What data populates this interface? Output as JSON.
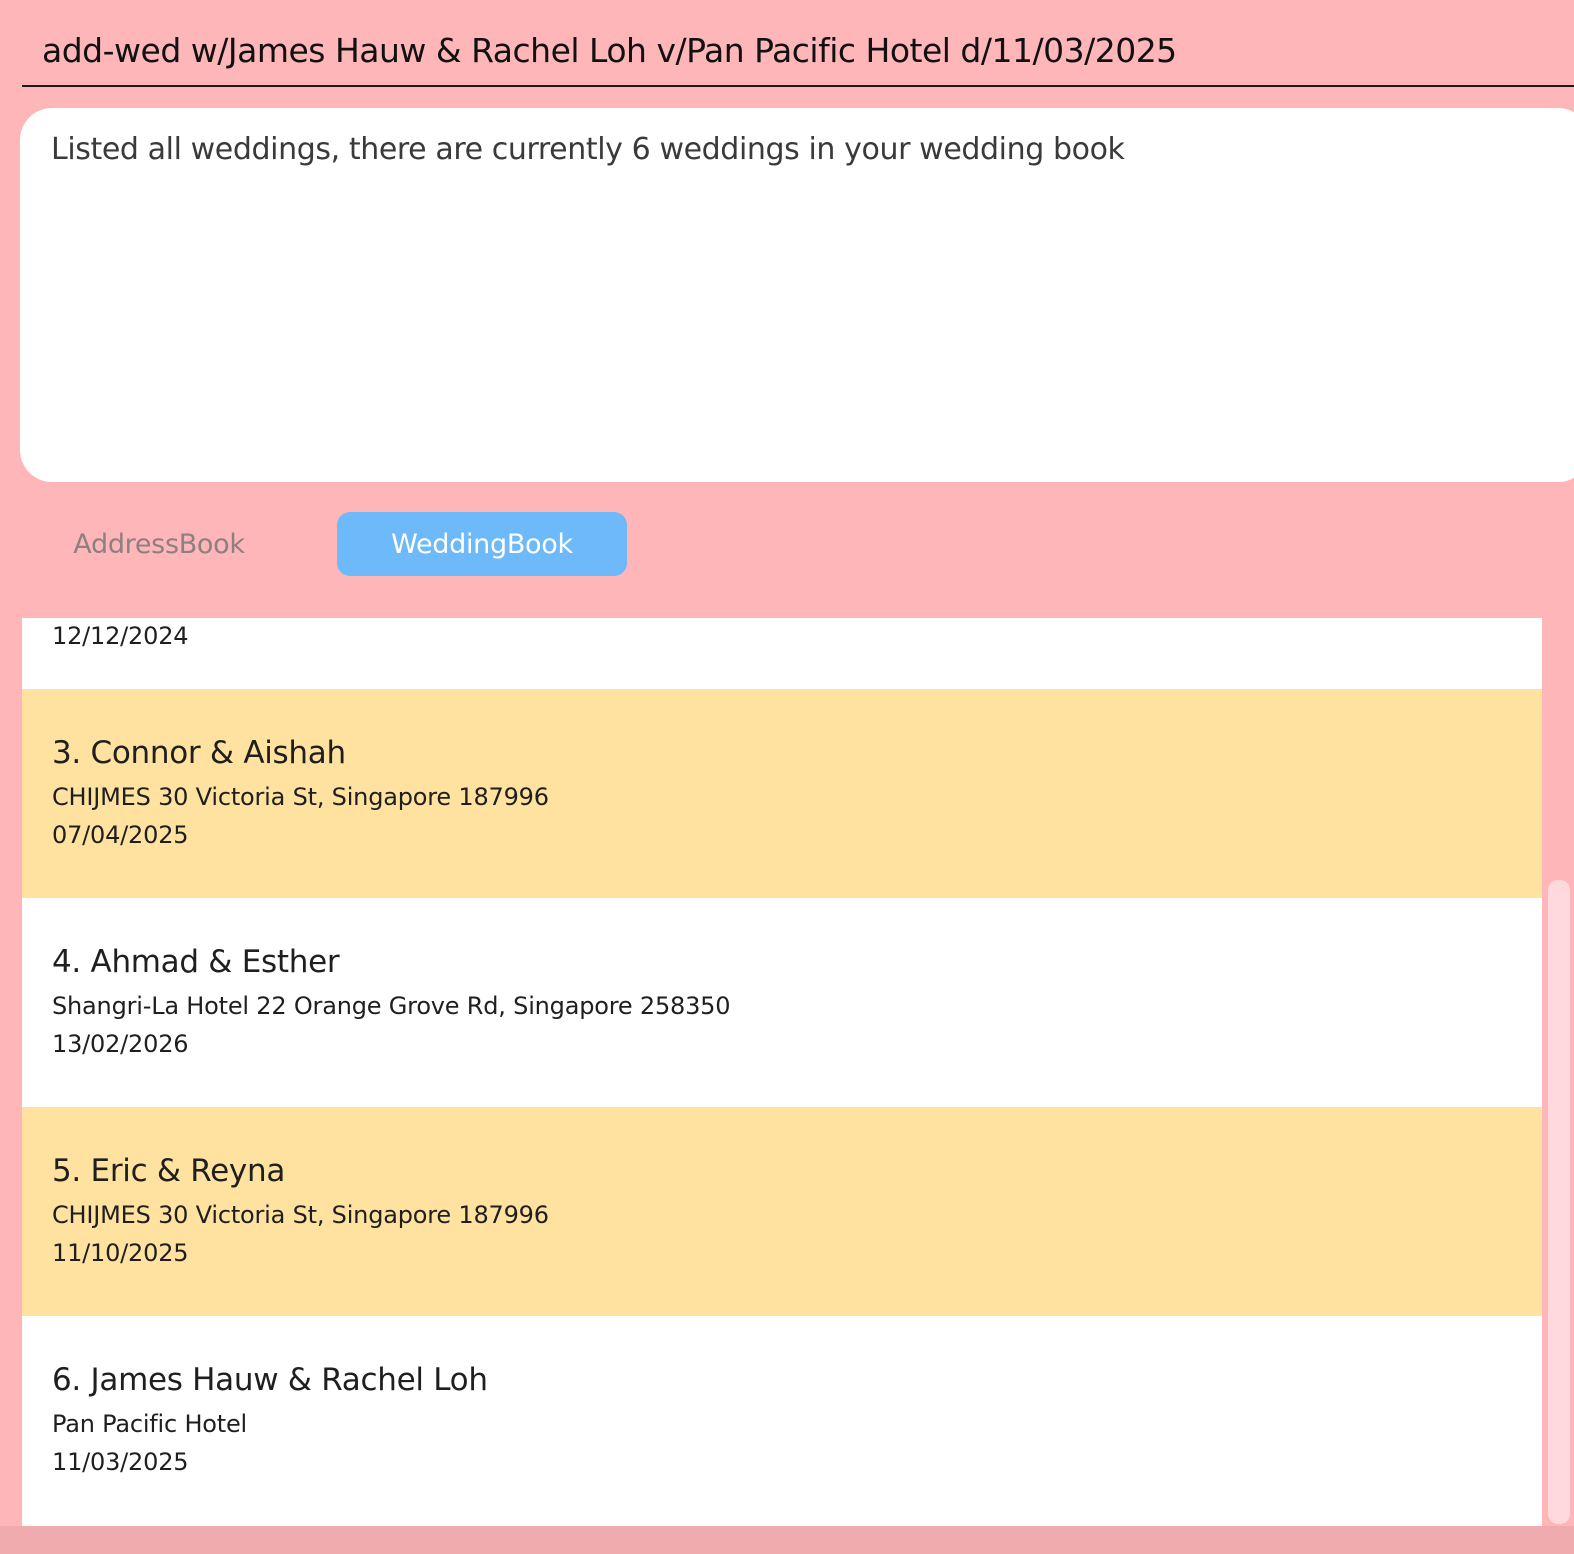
{
  "command": {
    "value": "add-wed w/James Hauw & Rachel Loh v/Pan Pacific Hotel d/11/03/2025"
  },
  "result": {
    "message": "Listed all weddings, there are currently 6 weddings in your wedding book"
  },
  "tabs": [
    {
      "label": "AddressBook",
      "selected": false
    },
    {
      "label": "WeddingBook",
      "selected": true
    }
  ],
  "colors": {
    "background": "#FFB6B9",
    "row_highlight": "#FFE29F",
    "selected_tab": "#6EB9FA"
  },
  "weddings": {
    "partial_date": "12/12/2024",
    "items": [
      {
        "name": "3. Connor & Aishah",
        "venue": "CHIJMES 30 Victoria St, Singapore 187996",
        "date": "07/04/2025"
      },
      {
        "name": "4. Ahmad & Esther",
        "venue": "Shangri-La Hotel 22 Orange Grove Rd, Singapore 258350",
        "date": "13/02/2026"
      },
      {
        "name": "5. Eric & Reyna",
        "venue": "CHIJMES 30 Victoria St, Singapore 187996",
        "date": "11/10/2025"
      },
      {
        "name": "6. James Hauw & Rachel Loh",
        "venue": "Pan Pacific Hotel",
        "date": "11/03/2025"
      }
    ]
  }
}
